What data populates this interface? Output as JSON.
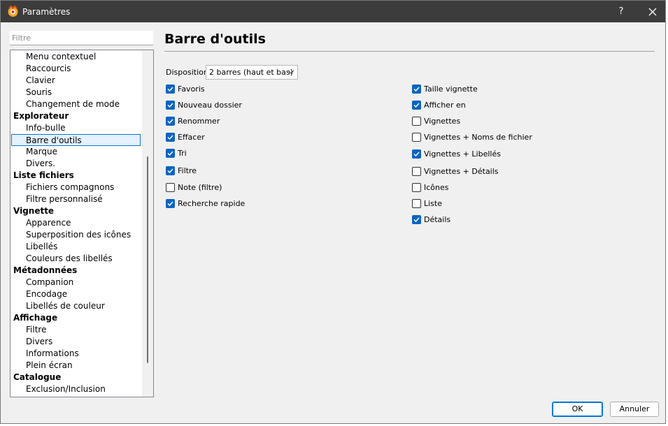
{
  "window": {
    "title": "Paramètres",
    "help_label": "?"
  },
  "filter": {
    "placeholder": "Filtre",
    "value": ""
  },
  "tree": [
    {
      "label": "Menu contextuel",
      "level": "child"
    },
    {
      "label": "Raccourcis",
      "level": "child"
    },
    {
      "label": "Clavier",
      "level": "child"
    },
    {
      "label": "Souris",
      "level": "child"
    },
    {
      "label": "Changement de mode",
      "level": "child"
    },
    {
      "label": "Explorateur",
      "level": "group"
    },
    {
      "label": "Info-bulle",
      "level": "child"
    },
    {
      "label": "Barre d'outils",
      "level": "child",
      "selected": true
    },
    {
      "label": "Marque",
      "level": "child"
    },
    {
      "label": "Divers.",
      "level": "child"
    },
    {
      "label": "Liste fichiers",
      "level": "group"
    },
    {
      "label": "Fichiers compagnons",
      "level": "child"
    },
    {
      "label": "Filtre personnalisé",
      "level": "child"
    },
    {
      "label": "Vignette",
      "level": "group"
    },
    {
      "label": "Apparence",
      "level": "child"
    },
    {
      "label": "Superposition des icônes",
      "level": "child"
    },
    {
      "label": "Libellés",
      "level": "child"
    },
    {
      "label": "Couleurs des libellés",
      "level": "child"
    },
    {
      "label": "Métadonnées",
      "level": "group"
    },
    {
      "label": "Companion",
      "level": "child"
    },
    {
      "label": "Encodage",
      "level": "child"
    },
    {
      "label": "Libellés de couleur",
      "level": "child"
    },
    {
      "label": "Affichage",
      "level": "group"
    },
    {
      "label": "Filtre",
      "level": "child"
    },
    {
      "label": "Divers",
      "level": "child"
    },
    {
      "label": "Informations",
      "level": "child"
    },
    {
      "label": "Plein écran",
      "level": "child"
    },
    {
      "label": "Catalogue",
      "level": "group"
    },
    {
      "label": "Exclusion/Inclusion",
      "level": "child"
    }
  ],
  "panel": {
    "title": "Barre d'outils",
    "disposition_label": "Disposition",
    "disposition_value": "2 barres (haut et bas)",
    "left_checks": [
      {
        "label": "Favoris",
        "checked": true
      },
      {
        "label": "Nouveau dossier",
        "checked": true
      },
      {
        "label": "Renommer",
        "checked": true
      },
      {
        "label": "Effacer",
        "checked": true
      },
      {
        "label": "Tri",
        "checked": true
      },
      {
        "label": "Filtre",
        "checked": true
      },
      {
        "label": "Note (filtre)",
        "checked": false
      },
      {
        "label": "Recherche rapide",
        "checked": true
      }
    ],
    "right_checks": [
      {
        "label": "Taille vignette",
        "checked": true
      },
      {
        "label": "Afficher en",
        "checked": true
      },
      {
        "label": "Vignettes",
        "checked": false
      },
      {
        "label": "Vignettes + Noms de fichier",
        "checked": false
      },
      {
        "label": "Vignettes + Libellés",
        "checked": true
      },
      {
        "label": "Vignettes + Détails",
        "checked": false
      },
      {
        "label": "Icônes",
        "checked": false
      },
      {
        "label": "Liste",
        "checked": false
      },
      {
        "label": "Détails",
        "checked": true
      }
    ]
  },
  "buttons": {
    "ok": "OK",
    "cancel": "Annuler"
  },
  "colors": {
    "titlebar": "#3c3c3c",
    "checkbox_on": "#0a64c2",
    "selection_border": "#0078d7",
    "selection_fill": "#e5f1fb"
  }
}
